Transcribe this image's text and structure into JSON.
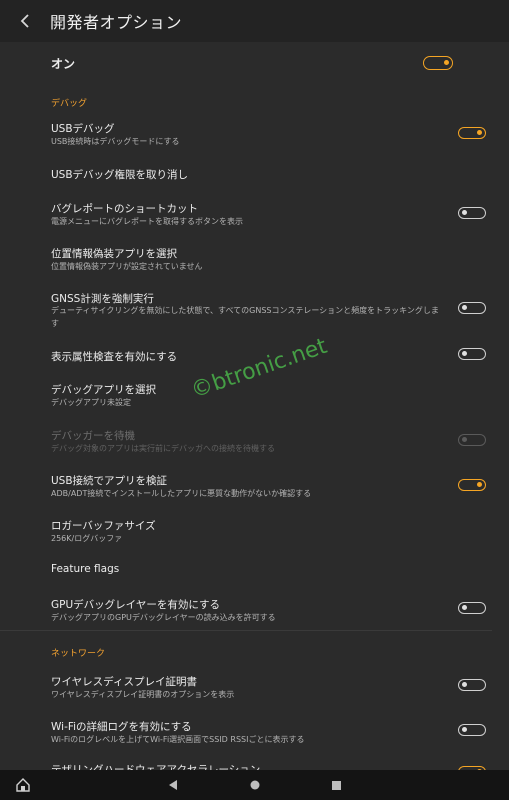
{
  "header": {
    "title": "開発者オプション"
  },
  "master": {
    "label": "オン"
  },
  "sections": {
    "debug": "デバッグ",
    "network": "ネットワーク"
  },
  "items": {
    "usb_debug": {
      "title": "USBデバッグ",
      "sub": "USB接続時はデバッグモードにする",
      "state": "on"
    },
    "revoke": {
      "title": "USBデバッグ権限を取り消し"
    },
    "bugreport": {
      "title": "バグレポートのショートカット",
      "sub": "電源メニューにバグレポートを取得するボタンを表示",
      "state": "off"
    },
    "mock_location": {
      "title": "位置情報偽装アプリを選択",
      "sub": "位置情報偽装アプリが設定されていません"
    },
    "gnss": {
      "title": "GNSS計測を強制実行",
      "sub": "デューティサイクリングを無効にした状態で、すべてのGNSSコンステレーションと頻度をトラッキングします",
      "state": "off"
    },
    "view_attr": {
      "title": "表示属性検査を有効にする",
      "state": "off"
    },
    "debug_app": {
      "title": "デバッグアプリを選択",
      "sub": "デバッグアプリ未設定"
    },
    "wait_debugger": {
      "title": "デバッガーを待機",
      "sub": "デバッグ対象のアプリは実行前にデバッガへの接続を待機する",
      "state": "disabled"
    },
    "verify_usb": {
      "title": "USB接続でアプリを検証",
      "sub": "ADB/ADT接続でインストールしたアプリに悪質な動作がないか確認する",
      "state": "on"
    },
    "logger": {
      "title": "ロガーバッファサイズ",
      "sub": "256K/ログバッファ"
    },
    "feature_flags": {
      "title": "Feature flags"
    },
    "gpu_layers": {
      "title": "GPUデバッグレイヤーを有効にする",
      "sub": "デバッグアプリのGPUデバッグレイヤーの読み込みを許可する",
      "state": "off"
    },
    "wireless_display": {
      "title": "ワイヤレスディスプレイ証明書",
      "sub": "ワイヤレスディスプレイ証明書のオプションを表示",
      "state": "off"
    },
    "wifi_log": {
      "title": "Wi-Fiの詳細ログを有効にする",
      "sub": "Wi-Fiのログレベルを上げてWi-Fi選択画面でSSID RSSIごとに表示する",
      "state": "off"
    },
    "tethering": {
      "title": "テザリングハードウェアアクセラレーション"
    }
  },
  "watermark": "©btronic.net",
  "colors": {
    "accent": "#f5a524",
    "background": "#2b2b2b",
    "watermark": "#4ab34a"
  },
  "icons": {
    "back": "chevron-left",
    "nav_home_app": "home-app",
    "nav_back": "triangle-left",
    "nav_home": "circle",
    "nav_recents": "square"
  }
}
